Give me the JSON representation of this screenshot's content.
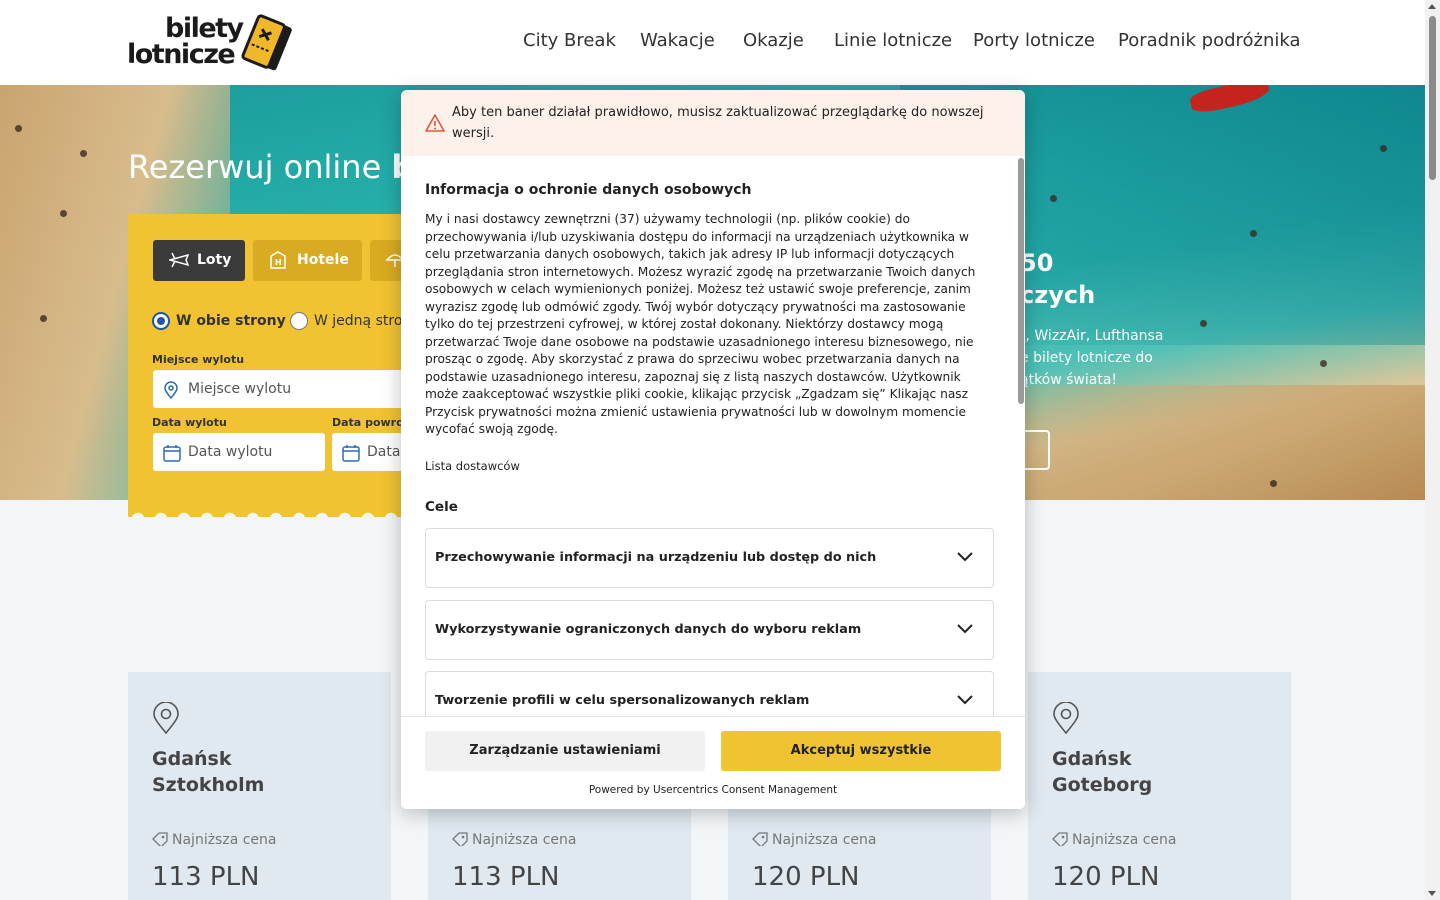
{
  "header": {
    "logo_line1": "bilety",
    "logo_line2": "lotnicze",
    "nav": [
      "City Break",
      "Wakacje",
      "Okazje",
      "Linie lotnicze",
      "Porty lotnicze",
      "Poradnik podróżnika"
    ]
  },
  "hero": {
    "title_regular": "Rezerwuj online ",
    "title_bold": "bi",
    "right_line1": "50",
    "right_line2": "czych",
    "right_text1": "t, WizzAir, Lufthansa",
    "right_text2": "e bilety lotnicze do",
    "right_text3": "ątków świata!",
    "button_fragment": "!"
  },
  "search": {
    "tabs": {
      "flights": "Loty",
      "hotels": "Hotele"
    },
    "radio_round": "W obie strony",
    "radio_oneway": "W jedną stron",
    "origin_label": "Miejsce wylotu",
    "origin_placeholder": "Miejsce wylotu",
    "depart_label": "Data wylotu",
    "depart_placeholder": "Data wylotu",
    "return_label": "Data powrotu",
    "return_placeholder": "Data"
  },
  "cards": [
    {
      "line1": "Gdańsk",
      "line2": "Sztokholm",
      "label": "Najniższa cena",
      "price": "113 PLN"
    },
    {
      "label": "Najniższa cena",
      "price": "113 PLN"
    },
    {
      "label": "Najniższa cena",
      "price": "120 PLN"
    },
    {
      "line1": "Gdańsk",
      "line2": "Goteborg",
      "label": "Najniższa cena",
      "price": "120 PLN"
    }
  ],
  "consent": {
    "warning": "Aby ten baner działał prawidłowo, musisz zaktualizować przeglądarkę do nowszej wersji.",
    "title": "Informacja o ochronie danych osobowych",
    "body": "My i nasi dostawcy zewnętrzni (37) używamy technologii (np. plików cookie) do przechowywania i/lub uzyskiwania dostępu do informacji na urządzeniach użytkownika w celu przetwarzania danych osobowych, takich jak adresy IP lub informacji dotyczących przeglądania stron internetowych. Możesz wyrazić zgodę na przetwarzanie Twoich danych osobowych w celach wymienionych poniżej. Możesz też ustawić swoje preferencje, zanim wyrazisz zgodę lub odmówić zgody. Twój wybór dotyczący prywatności ma zastosowanie tylko do tej przestrzeni cyfrowej, w której został dokonany. Niektórzy dostawcy mogą przetwarzać Twoje dane osobowe na podstawie uzasadnionego interesu biznesowego, nie prosząc o zgodę. Aby skorzystać z prawa do sprzeciwu wobec przetwarzania danych na podstawie uzasadnionego interesu, zapoznaj się z listą naszych dostawców. Użytkownik może zaakceptować wszystkie pliki cookie, klikając przycisk „Zgadzam się” Klikając nasz Przycisk prywatności można zmienić ustawienia prywatności lub w dowolnym momencie wycofać swoją zgodę.",
    "vendors_link": "Lista dostawców",
    "purposes_heading": "Cele",
    "purposes": [
      "Przechowywanie informacji na urządzeniu lub dostęp do nich",
      "Wykorzystywanie ograniczonych danych do wyboru reklam",
      "Tworzenie profili w celu spersonalizowanych reklam"
    ],
    "manage_button": "Zarządzanie ustawieniami",
    "accept_button": "Akceptuj wszystkie",
    "powered_by": "Powered by Usercentrics Consent Management"
  },
  "colors": {
    "brand_yellow": "#efc332",
    "dark": "#3b3b3b",
    "warning_bg": "#fdf1ea"
  }
}
